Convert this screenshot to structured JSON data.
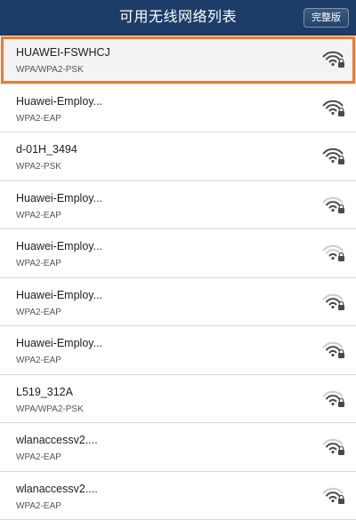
{
  "header": {
    "title": "可用无线网络列表",
    "full_version_label": "完整版"
  },
  "networks": [
    {
      "ssid": "HUAWEI-FSWHCJ",
      "security": "WPA/WPA2-PSK",
      "selected": true,
      "signal_bars": 3
    },
    {
      "ssid": "Huawei-Employ...",
      "security": "WPA2-EAP",
      "selected": false,
      "signal_bars": 3
    },
    {
      "ssid": "d-01H_3494",
      "security": "WPA2-PSK",
      "selected": false,
      "signal_bars": 3
    },
    {
      "ssid": "Huawei-Employ...",
      "security": "WPA2-EAP",
      "selected": false,
      "signal_bars": 2
    },
    {
      "ssid": "Huawei-Employ...",
      "security": "WPA2-EAP",
      "selected": false,
      "signal_bars": 1
    },
    {
      "ssid": "Huawei-Employ...",
      "security": "WPA2-EAP",
      "selected": false,
      "signal_bars": 2
    },
    {
      "ssid": "Huawei-Employ...",
      "security": "WPA2-EAP",
      "selected": false,
      "signal_bars": 2
    },
    {
      "ssid": "L519_312A",
      "security": "WPA/WPA2-PSK",
      "selected": false,
      "signal_bars": 2
    },
    {
      "ssid": "wlanaccessv2....",
      "security": "WPA2-EAP",
      "selected": false,
      "signal_bars": 2
    },
    {
      "ssid": "wlanaccessv2....",
      "security": "WPA2-EAP",
      "selected": false,
      "signal_bars": 2
    }
  ],
  "colors": {
    "header_bg": "#1c3d67",
    "selected_border": "#f07a2a",
    "signal_active": "#4a4a4a",
    "signal_inactive": "#cccccc"
  },
  "icons": {
    "signal": "wifi-locked-icon"
  }
}
